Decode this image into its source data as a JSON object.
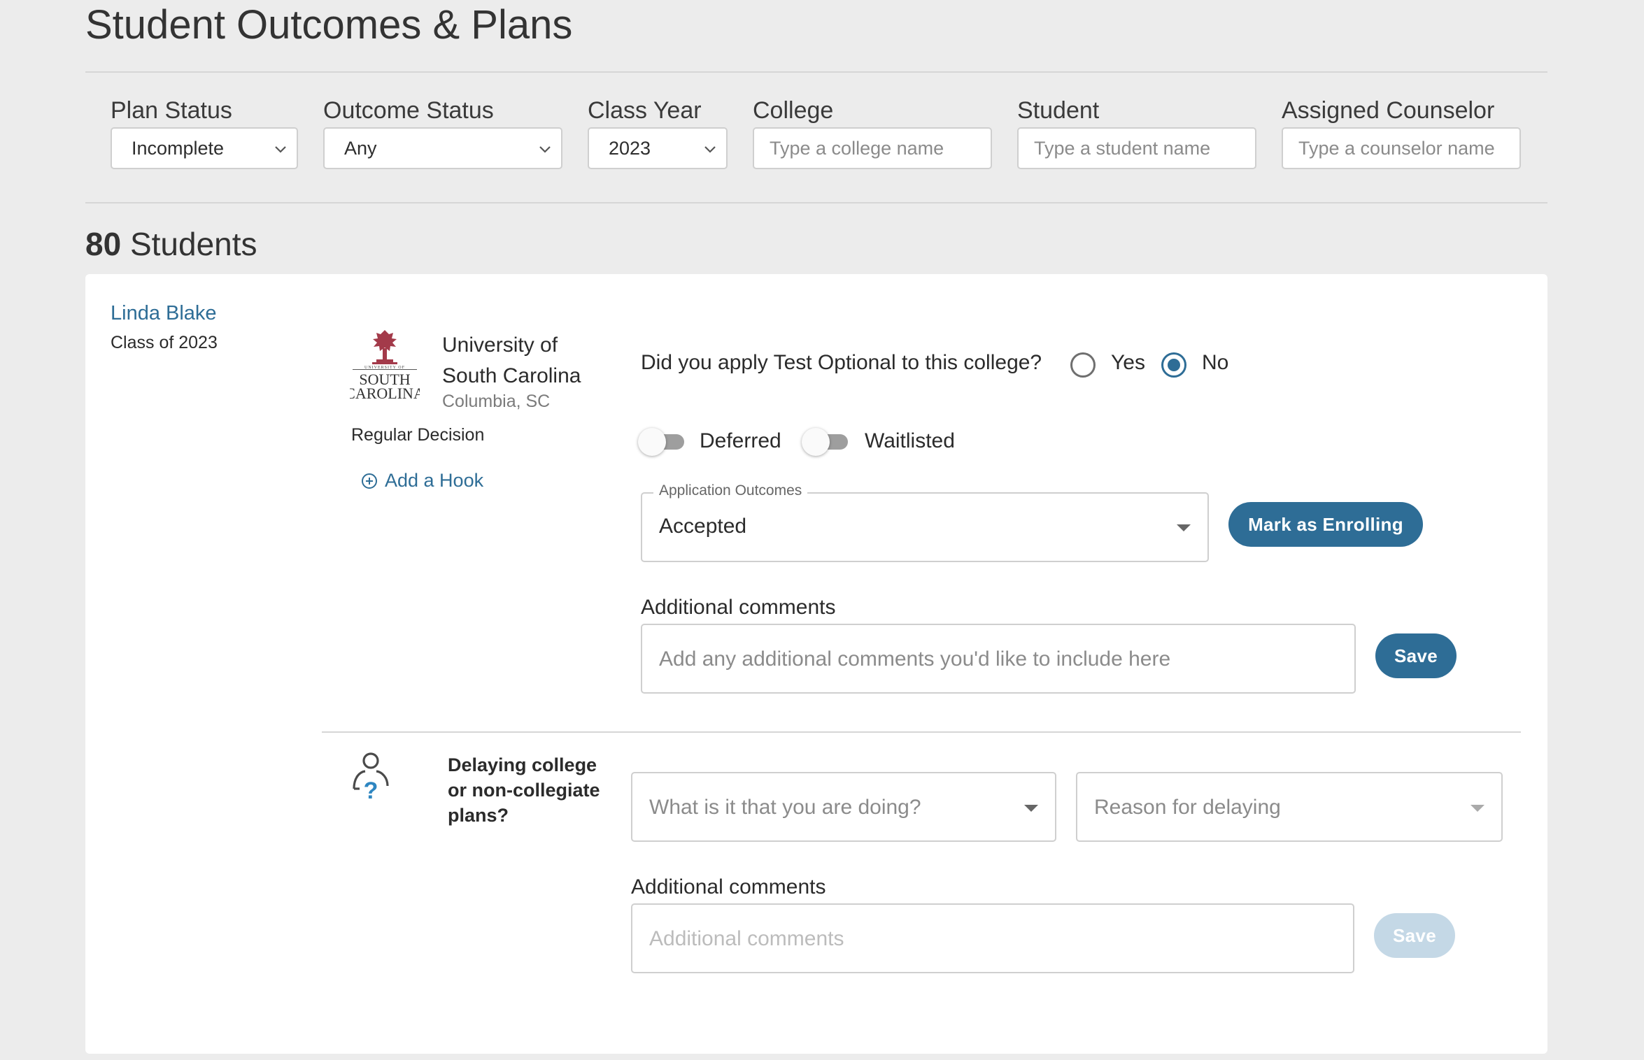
{
  "page": {
    "title": "Student Outcomes & Plans"
  },
  "filters": {
    "plan_status": {
      "label": "Plan Status",
      "value": "Incomplete"
    },
    "outcome_status": {
      "label": "Outcome Status",
      "value": "Any"
    },
    "class_year": {
      "label": "Class Year",
      "value": "2023"
    },
    "college": {
      "label": "College",
      "placeholder": "Type a college name"
    },
    "student": {
      "label": "Student",
      "placeholder": "Type a student name"
    },
    "counselor": {
      "label": "Assigned Counselor",
      "placeholder": "Type a counselor name"
    }
  },
  "summary": {
    "count": "80",
    "count_label": "Students"
  },
  "student": {
    "name": "Linda Blake",
    "class": "Class of 2023"
  },
  "college": {
    "name_line1": "University of",
    "name_line2": "South Carolina",
    "location": "Columbia, SC",
    "decision": "Regular Decision",
    "add_hook": "Add a Hook",
    "logo_text_top": "UNIVERSITY OF",
    "logo_text_mid": "SOUTH",
    "logo_text_bot": "CAROLINA"
  },
  "test_optional": {
    "question": "Did you apply Test Optional to this college?",
    "yes_label": "Yes",
    "no_label": "No",
    "selected": "No"
  },
  "toggles": {
    "deferred_label": "Deferred",
    "waitlisted_label": "Waitlisted",
    "deferred_on": false,
    "waitlisted_on": false
  },
  "application": {
    "outcomes_legend": "Application Outcomes",
    "outcome_value": "Accepted",
    "enroll_button": "Mark as Enrolling",
    "comments_label": "Additional comments",
    "comments_placeholder": "Add any additional comments you'd like to include here",
    "save_button": "Save"
  },
  "delay": {
    "question_line1": "Delaying college",
    "question_line2": "or non-collegiate",
    "question_line3": "plans?",
    "doing_placeholder": "What is it that you are doing?",
    "reason_placeholder": "Reason for delaying",
    "comments_label": "Additional comments",
    "comments_placeholder": "Additional comments",
    "save_button": "Save"
  },
  "colors": {
    "accent": "#2e6d96",
    "accent_disabled": "#c4d8e6",
    "background": "#ececec",
    "card": "#ffffff"
  }
}
